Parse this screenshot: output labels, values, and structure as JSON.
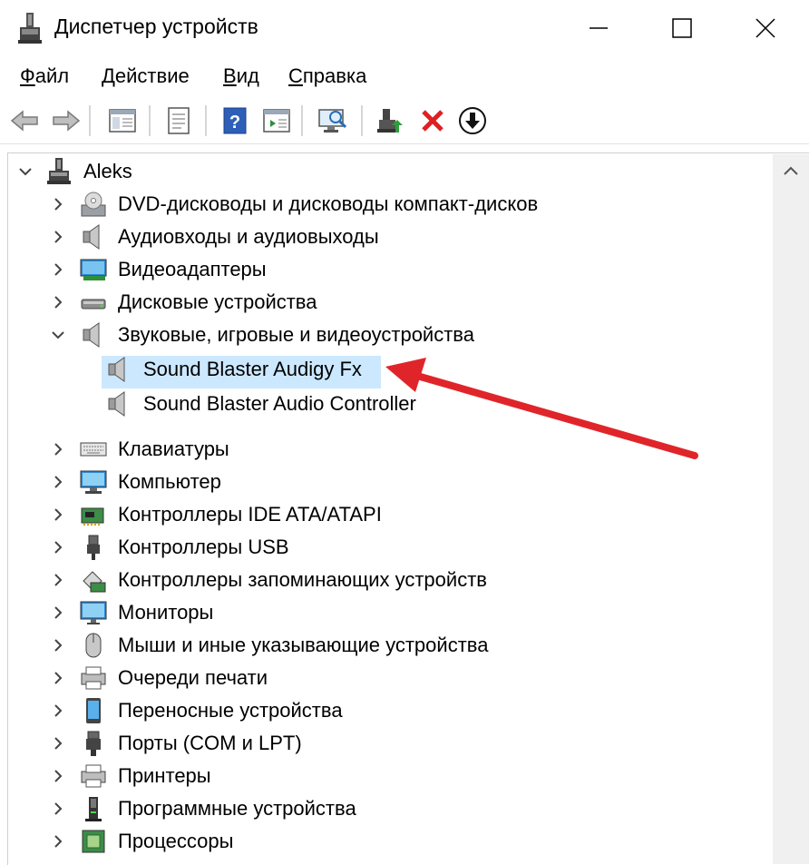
{
  "window": {
    "title": "Диспетчер устройств",
    "minimize_glyph": "—",
    "maximize_glyph": "☐",
    "close_glyph": "✕"
  },
  "menu": {
    "file": {
      "accel": "Ф",
      "rest": "айл"
    },
    "action": {
      "accel": "Д",
      "rest": "ействие"
    },
    "view": {
      "accel": "В",
      "rest": "ид"
    },
    "help": {
      "accel": "С",
      "rest": "правка"
    }
  },
  "toolbar": {
    "icons": [
      "back-arrow-icon",
      "forward-arrow-icon",
      "properties-panel-icon",
      "driver-doc-icon",
      "help-icon",
      "view-panel-icon",
      "scan-hardware-icon",
      "update-driver-icon",
      "uninstall-x-icon",
      "download-icon"
    ]
  },
  "tree": {
    "root": "Aleks",
    "categories": [
      {
        "label": "DVD-дисководы и дисководы компакт-дисков",
        "icon": "dvd-drive-icon"
      },
      {
        "label": "Аудиовходы и аудиовыходы",
        "icon": "speaker-icon"
      },
      {
        "label": "Видеоадаптеры",
        "icon": "display-adapter-icon"
      },
      {
        "label": "Дисковые устройства",
        "icon": "disk-drive-icon"
      },
      {
        "label": "Звуковые, игровые и видеоустройства",
        "icon": "speaker-icon",
        "expanded": true
      },
      {
        "label": "Клавиатуры",
        "icon": "keyboard-icon"
      },
      {
        "label": "Компьютер",
        "icon": "computer-icon"
      },
      {
        "label": "Контроллеры IDE ATA/ATAPI",
        "icon": "ide-controller-icon"
      },
      {
        "label": "Контроллеры USB",
        "icon": "usb-icon"
      },
      {
        "label": "Контроллеры запоминающих устройств",
        "icon": "storage-controller-icon"
      },
      {
        "label": "Мониторы",
        "icon": "monitor-icon"
      },
      {
        "label": "Мыши и иные указывающие устройства",
        "icon": "mouse-icon"
      },
      {
        "label": "Очереди печати",
        "icon": "print-queue-icon"
      },
      {
        "label": "Переносные устройства",
        "icon": "portable-device-icon"
      },
      {
        "label": "Порты (COM и LPT)",
        "icon": "port-icon"
      },
      {
        "label": "Принтеры",
        "icon": "printer-icon"
      },
      {
        "label": "Программные устройства",
        "icon": "software-device-icon"
      },
      {
        "label": "Процессоры",
        "icon": "processor-icon"
      }
    ],
    "sound_children": [
      {
        "label": "Sound Blaster Audigy Fx",
        "selected": true
      },
      {
        "label": "Sound Blaster Audio Controller",
        "selected": false
      }
    ]
  },
  "annotation": {
    "arrow_color": "#e0252a"
  },
  "colors": {
    "selection": "#cce8ff",
    "delete_red": "#e02020",
    "help_blue": "#2d5fb8"
  }
}
